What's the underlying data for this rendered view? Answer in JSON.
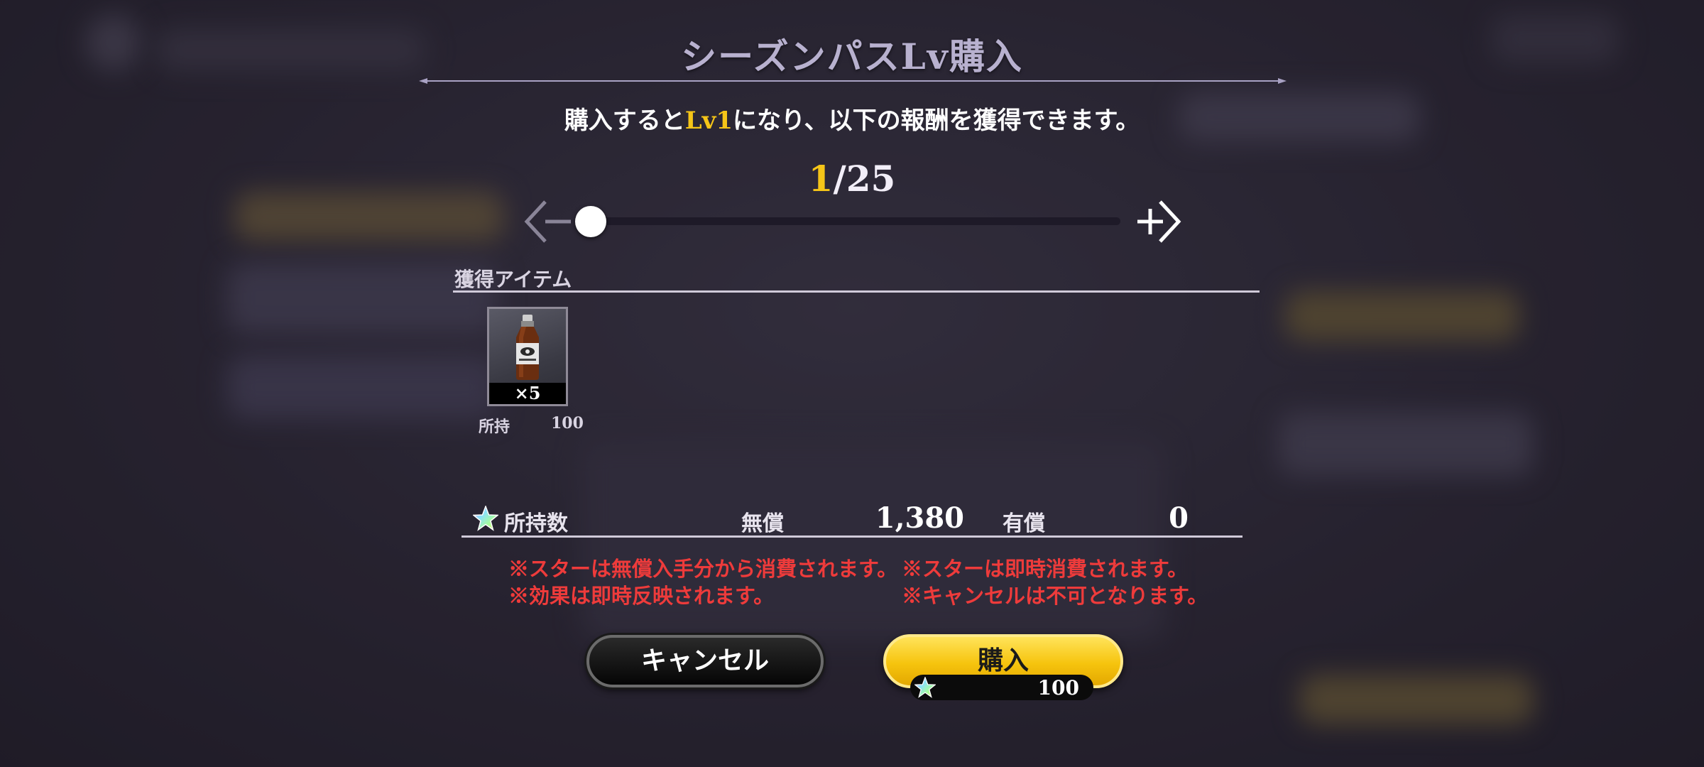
{
  "dialog": {
    "title": "シーズンパスLv購入",
    "subtitle_prefix": "購入すると",
    "subtitle_level": "Lv1",
    "subtitle_suffix": "になり、以下の報酬を獲得できます。",
    "counter_current": "1",
    "counter_total": "/25",
    "slider": {
      "value": 1,
      "min": 1,
      "max": 25
    },
    "items_section_label": "獲得アイテム",
    "items": [
      {
        "icon": "drink-bottle-icon",
        "count": "×5",
        "owned_label": "所持",
        "owned_value": "100"
      }
    ],
    "stars": {
      "icon": "rainbow-star-icon",
      "label": "所持数",
      "free_label": "無償",
      "free_value": "1,380",
      "paid_label": "有償",
      "paid_value": "0"
    },
    "notes": [
      "※スターは無償入手分から消費されます。",
      "※スターは即時消費されます。",
      "※効果は即時反映されます。",
      "※キャンセルは不可となります。"
    ],
    "cancel_label": "キャンセル",
    "buy_label": "購入",
    "buy_cost": "100"
  },
  "colors": {
    "accent_gold": "#f5c518",
    "note_red": "#ee3b3b",
    "title_lavender": "#b8b1cf",
    "button_yellow": "#f6c40e"
  }
}
